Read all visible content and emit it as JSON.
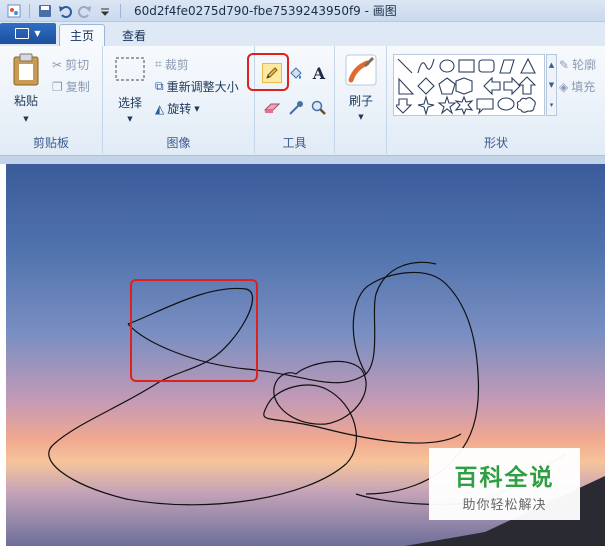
{
  "window": {
    "title": "60d2f4fe0275d790-fbe7539243950f9 - 画图"
  },
  "tabs": [
    {
      "label": "主页"
    },
    {
      "label": "查看"
    }
  ],
  "clipboard": {
    "paste": "粘贴",
    "cut": "剪切",
    "copy": "复制",
    "label": "剪贴板"
  },
  "image": {
    "select": "选择",
    "crop": "裁剪",
    "resize": "重新调整大小",
    "rotate": "旋转",
    "label": "图像"
  },
  "tools": {
    "label": "工具"
  },
  "brushes": {
    "label": "刷子"
  },
  "shapes": {
    "label": "形状",
    "outline": "轮廓",
    "fill": "填充"
  },
  "watermark": {
    "main": "百科全说",
    "sub": "助你轻松解决"
  },
  "colors": {
    "highlight": "#e0201c",
    "watermark_green": "#2ea043"
  }
}
